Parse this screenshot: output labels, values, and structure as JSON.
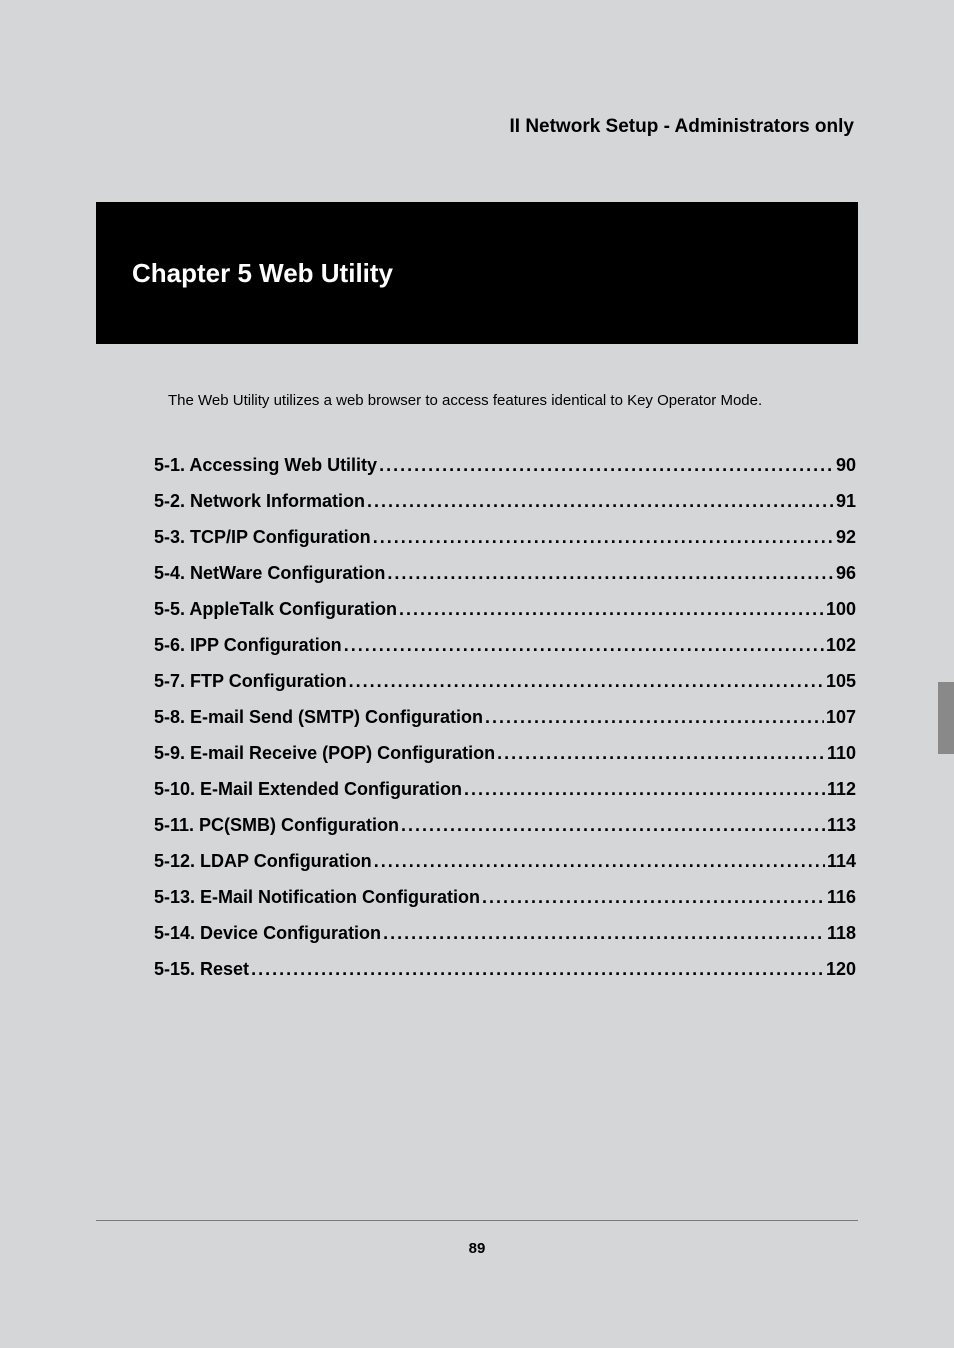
{
  "header": "II Network Setup - Administrators only",
  "chapter_title": "Chapter 5 Web Utility",
  "intro": "The Web Utility utilizes a web browser to access features identical to Key Operator Mode.",
  "toc": [
    {
      "title": "5-1. Accessing Web Utility",
      "page": "90"
    },
    {
      "title": "5-2. Network Information",
      "page": "91"
    },
    {
      "title": "5-3. TCP/IP Configuration",
      "page": "92"
    },
    {
      "title": "5-4. NetWare Configuration",
      "page": "96"
    },
    {
      "title": "5-5. AppleTalk Configuration",
      "page": "100"
    },
    {
      "title": "5-6. IPP Configuration",
      "page": "102"
    },
    {
      "title": "5-7. FTP Configuration",
      "page": "105"
    },
    {
      "title": "5-8. E-mail Send (SMTP) Configuration",
      "page": "107"
    },
    {
      "title": "5-9. E-mail Receive (POP) Configuration",
      "page": "110"
    },
    {
      "title": "5-10. E-Mail Extended Configuration",
      "page": "112"
    },
    {
      "title": "5-11. PC(SMB) Configuration",
      "page": "113"
    },
    {
      "title": "5-12. LDAP Configuration",
      "page": "114"
    },
    {
      "title": "5-13. E-Mail Notification Configuration",
      "page": "116"
    },
    {
      "title": "5-14. Device Configuration",
      "page": "118"
    },
    {
      "title": "5-15. Reset",
      "page": "120"
    }
  ],
  "page_number": "89"
}
